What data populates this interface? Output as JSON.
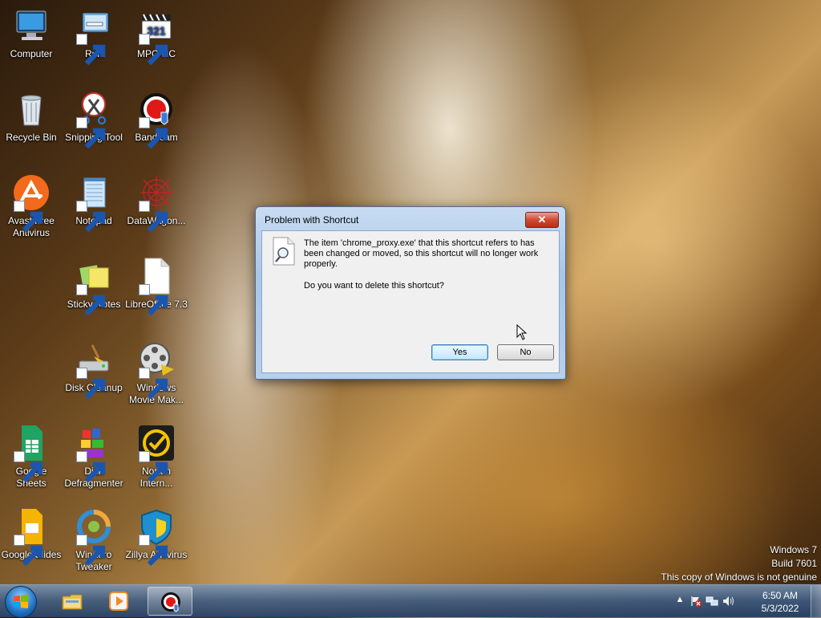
{
  "desktop": {
    "icons": [
      {
        "label": "Computer",
        "icon": "computer-icon"
      },
      {
        "label": "Run",
        "icon": "run-icon"
      },
      {
        "label": "MPC-HC",
        "icon": "mpc-hc-icon"
      },
      {
        "label": "Recycle Bin",
        "icon": "recycle-bin-icon"
      },
      {
        "label": "Snipping Tool",
        "icon": "snipping-tool-icon"
      },
      {
        "label": "Bandicam",
        "icon": "bandicam-icon"
      },
      {
        "label": "Avast Free Antivirus",
        "icon": "avast-icon"
      },
      {
        "label": "Notepad",
        "icon": "notepad-icon"
      },
      {
        "label": "DataWagon...",
        "icon": "datawagon-icon"
      },
      {
        "label": "Sticky Notes",
        "icon": "sticky-notes-icon"
      },
      {
        "label": "LibreOffice 7.3",
        "icon": "libreoffice-icon"
      },
      {
        "label": "Disk Cleanup",
        "icon": "disk-cleanup-icon"
      },
      {
        "label": "Windows Movie Mak...",
        "icon": "movie-maker-icon"
      },
      {
        "label": "Google Sheets",
        "icon": "google-sheets-icon"
      },
      {
        "label": "Disk Defragmenter",
        "icon": "defragmenter-icon"
      },
      {
        "label": "Norton Intern...",
        "icon": "norton-icon"
      },
      {
        "label": "Google Slides",
        "icon": "google-slides-icon"
      },
      {
        "label": "Winaero Tweaker",
        "icon": "winaero-icon"
      },
      {
        "label": "Zillya Antivirus",
        "icon": "zillya-icon"
      }
    ],
    "watermark": {
      "line1": "Windows 7",
      "line2": "Build 7601",
      "line3": "This copy of Windows is not genuine"
    }
  },
  "dialog": {
    "title": "Problem with Shortcut",
    "close_label": "✕",
    "message": "The item 'chrome_proxy.exe' that this shortcut refers to has been changed or moved, so this shortcut will no longer work properly.",
    "question": "Do you want to delete this shortcut?",
    "yes_label": "Yes",
    "no_label": "No"
  },
  "taskbar": {
    "pinned": [
      "explorer-icon",
      "media-player-icon",
      "bandicam-icon"
    ],
    "tray_icons": [
      "show-hidden-icons-chevron-icon",
      "action-center-flag-icon",
      "network-icon",
      "volume-icon"
    ],
    "clock": {
      "time": "6:50 AM",
      "date": "5/3/2022"
    }
  },
  "colors": {
    "dialog_close": "#cf4a33",
    "taskbar": "#3c5a82",
    "default_button_border": "#3c7fb1"
  }
}
